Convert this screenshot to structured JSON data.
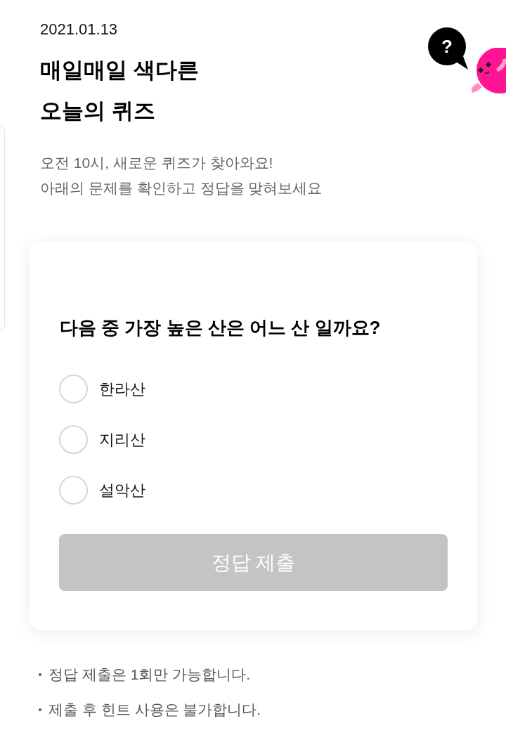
{
  "header": {
    "date": "2021.01.13",
    "title_lines": [
      "매일매일 색다른",
      "오늘의 퀴즈"
    ],
    "subtitle_lines": [
      "오전 10시, 새로운 퀴즈가 찾아와요!",
      "아래의 문제를 확인하고 정답을 맞혀보세요"
    ],
    "help_button": {
      "label": "?"
    }
  },
  "quiz": {
    "question": "다음 중 가장 높은 산은 어느 산 일까요?",
    "options": [
      {
        "label": "한라산",
        "selected": false
      },
      {
        "label": "지리산",
        "selected": false
      },
      {
        "label": "설악산",
        "selected": false
      }
    ],
    "submit_button": {
      "label": "정답 제출",
      "disabled": true
    }
  },
  "notes": [
    "정답 제출은 1회만 가능합니다.",
    "제출 후 힌트 사용은 불가합니다."
  ]
}
